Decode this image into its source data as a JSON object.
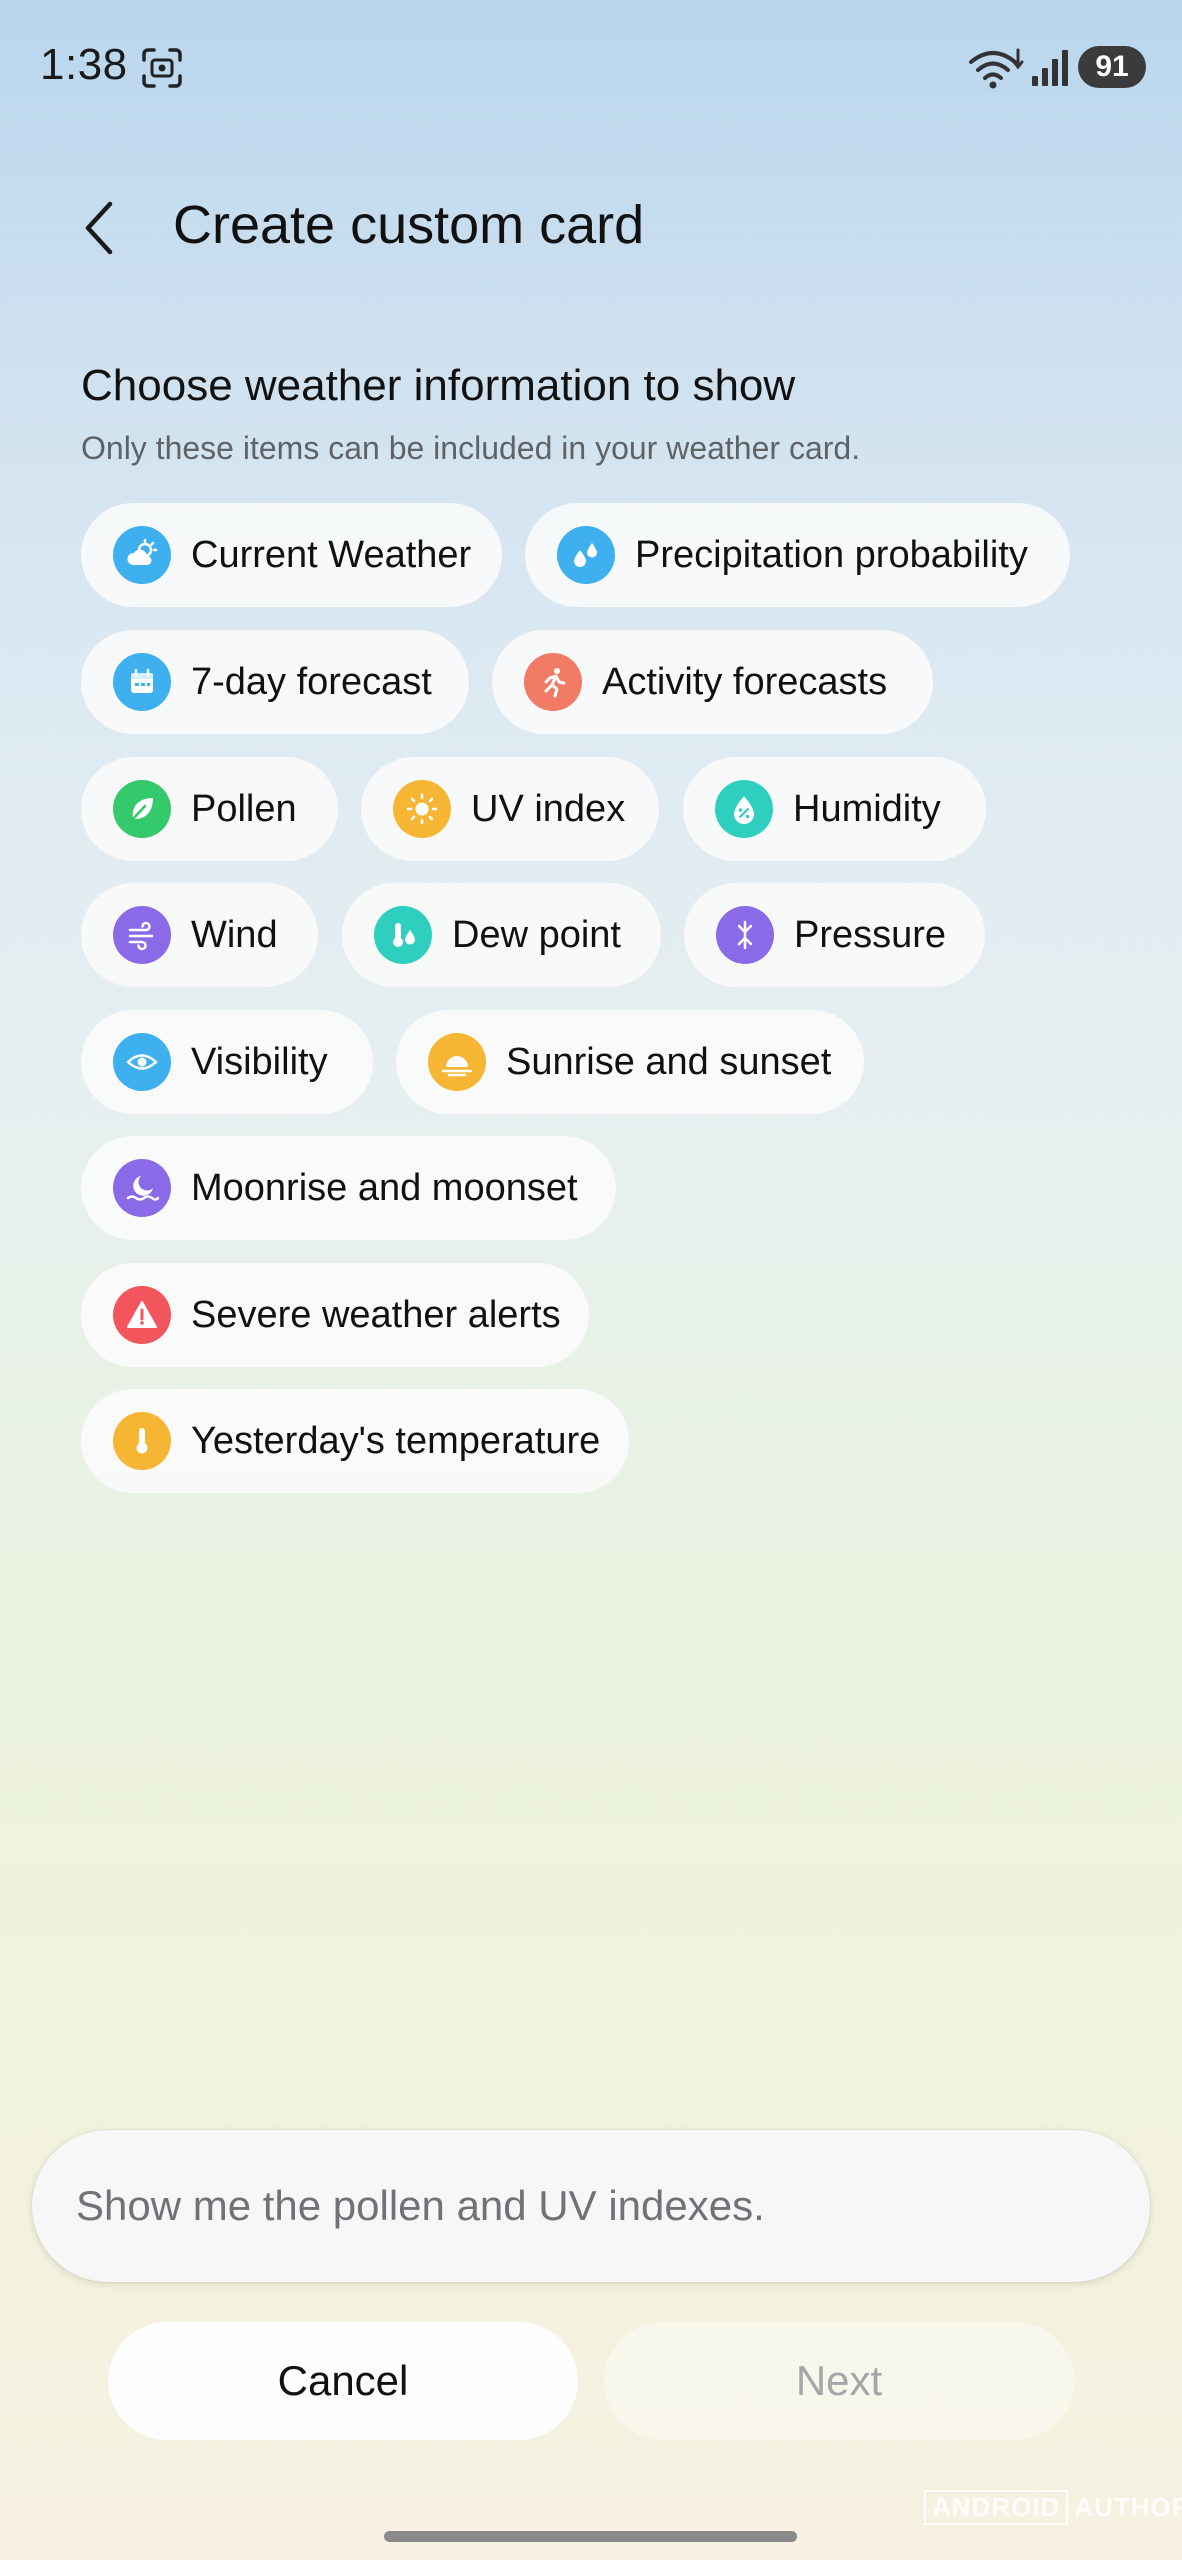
{
  "status_bar": {
    "time": "1:38",
    "battery": "91",
    "icons": [
      "screenshot-icon",
      "wifi-icon",
      "signal-icon"
    ]
  },
  "header": {
    "title": "Create custom card",
    "back_icon": "chevron-left-icon"
  },
  "section": {
    "title": "Choose weather information to show",
    "subtitle": "Only these items can be included in your weather card."
  },
  "chips": [
    {
      "label": "Current Weather",
      "icon": "partly-cloudy-icon",
      "color": "#3fb0ef"
    },
    {
      "label": "Precipitation probability",
      "icon": "raindrops-icon",
      "color": "#3fb0ef"
    },
    {
      "label": "7-day forecast",
      "icon": "calendar-icon",
      "color": "#3fb0ef"
    },
    {
      "label": "Activity forecasts",
      "icon": "running-person-icon",
      "color": "#f27b66"
    },
    {
      "label": "Pollen",
      "icon": "leaf-icon",
      "color": "#34c96a"
    },
    {
      "label": "UV index",
      "icon": "sun-icon",
      "color": "#f7b534"
    },
    {
      "label": "Humidity",
      "icon": "humidity-drop-icon",
      "color": "#2fcfbf"
    },
    {
      "label": "Wind",
      "icon": "wind-icon",
      "color": "#8b6ae8"
    },
    {
      "label": "Dew point",
      "icon": "thermometer-drop-icon",
      "color": "#2fcfbf"
    },
    {
      "label": "Pressure",
      "icon": "pressure-arrows-icon",
      "color": "#8b6ae8"
    },
    {
      "label": "Visibility",
      "icon": "eye-icon",
      "color": "#3fb0ef"
    },
    {
      "label": "Sunrise and sunset",
      "icon": "sunrise-icon",
      "color": "#f7b534"
    },
    {
      "label": "Moonrise and moonset",
      "icon": "moonrise-icon",
      "color": "#8b6ae8"
    },
    {
      "label": "Severe weather alerts",
      "icon": "warning-triangle-icon",
      "color": "#f2555c"
    },
    {
      "label": "Yesterday's temperature",
      "icon": "thermometer-icon",
      "color": "#f7b534"
    }
  ],
  "prompt": {
    "value": "Show me the pollen and UV indexes."
  },
  "actions": {
    "cancel_label": "Cancel",
    "next_label": "Next"
  },
  "watermark": {
    "brand_box": "ANDROID",
    "brand_tail": "AUTHORITY"
  }
}
